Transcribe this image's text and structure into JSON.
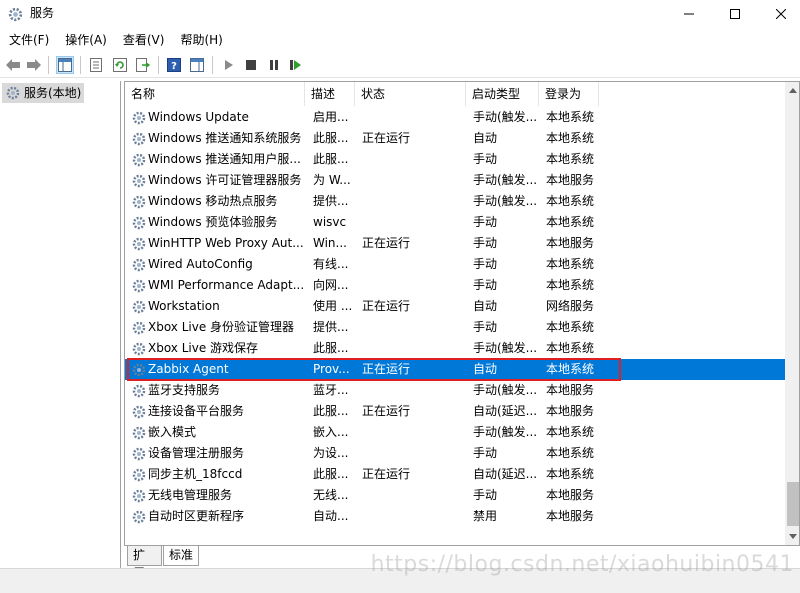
{
  "window": {
    "title": "服务",
    "min_glyph": "—",
    "max_glyph": "☐",
    "close_glyph": "✕"
  },
  "menu": [
    "文件(F)",
    "操作(A)",
    "查看(V)",
    "帮助(H)"
  ],
  "toolbar": {
    "icons": [
      "back-icon",
      "forward-icon",
      "show-hide-tree-icon",
      "properties-icon",
      "refresh-icon",
      "export-list-icon",
      "help-icon",
      "show-hide-action-pane-icon",
      "start-service-icon",
      "stop-service-icon",
      "pause-service-icon",
      "restart-service-icon"
    ]
  },
  "tree": {
    "label": "服务(本地)"
  },
  "columns": {
    "name": "名称",
    "desc": "描述",
    "status": "状态",
    "startup": "启动类型",
    "logon": "登录为"
  },
  "rows": [
    {
      "name": "Windows Update",
      "desc": "启用...",
      "status": "",
      "startup": "手动(触发...",
      "logon": "本地系统"
    },
    {
      "name": "Windows 推送通知系统服务",
      "desc": "此服...",
      "status": "正在运行",
      "startup": "自动",
      "logon": "本地系统"
    },
    {
      "name": "Windows 推送通知用户服...",
      "desc": "此服...",
      "status": "",
      "startup": "手动",
      "logon": "本地系统"
    },
    {
      "name": "Windows 许可证管理器服务",
      "desc": "为 W...",
      "status": "",
      "startup": "手动(触发...",
      "logon": "本地服务"
    },
    {
      "name": "Windows 移动热点服务",
      "desc": "提供...",
      "status": "",
      "startup": "手动(触发...",
      "logon": "本地系统"
    },
    {
      "name": "Windows 预览体验服务",
      "desc": "wisvc",
      "status": "",
      "startup": "手动",
      "logon": "本地系统"
    },
    {
      "name": "WinHTTP Web Proxy Aut...",
      "desc": "Win...",
      "status": "正在运行",
      "startup": "手动",
      "logon": "本地服务"
    },
    {
      "name": "Wired AutoConfig",
      "desc": "有线...",
      "status": "",
      "startup": "手动",
      "logon": "本地系统"
    },
    {
      "name": "WMI Performance Adapt...",
      "desc": "向网...",
      "status": "",
      "startup": "手动",
      "logon": "本地系统"
    },
    {
      "name": "Workstation",
      "desc": "使用 ...",
      "status": "正在运行",
      "startup": "自动",
      "logon": "网络服务"
    },
    {
      "name": "Xbox Live 身份验证管理器",
      "desc": "提供...",
      "status": "",
      "startup": "手动",
      "logon": "本地系统"
    },
    {
      "name": "Xbox Live 游戏保存",
      "desc": "此服...",
      "status": "",
      "startup": "手动(触发...",
      "logon": "本地系统"
    },
    {
      "name": "Zabbix Agent",
      "desc": "Prov...",
      "status": "正在运行",
      "startup": "自动",
      "logon": "本地系统",
      "selected": true
    },
    {
      "name": "蓝牙支持服务",
      "desc": "蓝牙...",
      "status": "",
      "startup": "手动(触发...",
      "logon": "本地服务"
    },
    {
      "name": "连接设备平台服务",
      "desc": "此服...",
      "status": "正在运行",
      "startup": "自动(延迟...",
      "logon": "本地服务"
    },
    {
      "name": "嵌入模式",
      "desc": "嵌入...",
      "status": "",
      "startup": "手动(触发...",
      "logon": "本地系统"
    },
    {
      "name": "设备管理注册服务",
      "desc": "为设...",
      "status": "",
      "startup": "手动",
      "logon": "本地系统"
    },
    {
      "name": "同步主机_18fccd",
      "desc": "此服...",
      "status": "正在运行",
      "startup": "自动(延迟...",
      "logon": "本地系统"
    },
    {
      "name": "无线电管理服务",
      "desc": "无线...",
      "status": "",
      "startup": "手动",
      "logon": "本地服务"
    },
    {
      "name": "自动时区更新程序",
      "desc": "自动...",
      "status": "",
      "startup": "禁用",
      "logon": "本地服务"
    }
  ],
  "tabs": [
    "扩展",
    "标准"
  ],
  "watermark": "https://blog.csdn.net/xiaohuibin0541",
  "colors": {
    "selection": "#0078d7",
    "highlight_box": "#e02020"
  }
}
